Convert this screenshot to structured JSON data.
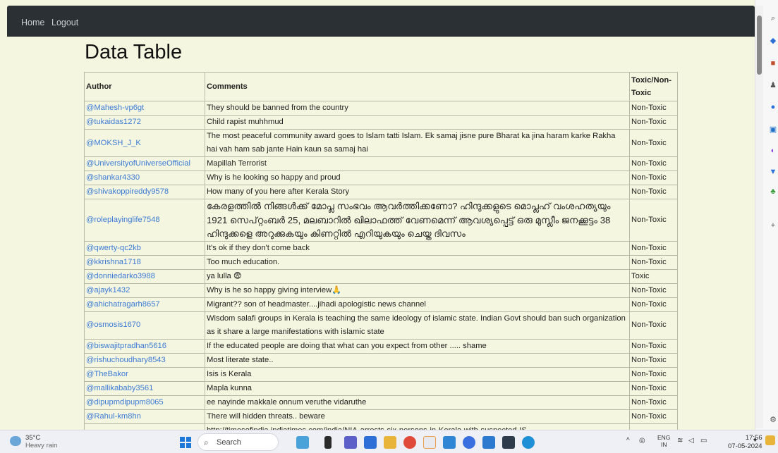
{
  "nav": {
    "home": "Home",
    "logout": "Logout"
  },
  "page_title": "Data Table",
  "table": {
    "headers": {
      "author": "Author",
      "comments": "Comments",
      "toxic": "Toxic/Non-Toxic"
    },
    "rows": [
      {
        "author": "@Mahesh-vp6gt",
        "comment": "They should be banned from the country",
        "label": "Non-Toxic"
      },
      {
        "author": "@tukaidas1272",
        "comment": "Child rapist muhhmud",
        "label": "Non-Toxic"
      },
      {
        "author": "@MOKSH_J_K",
        "comment": "The most peaceful community award goes to Islam tatti Islam. Ek samaj jisne pure Bharat ka jina haram karke Rakha hai vah ham sab jante Hain kaun sa samaj hai",
        "label": "Non-Toxic"
      },
      {
        "author": "@UniversityofUniverseOfficial",
        "comment": "Mapillah Terrorist",
        "label": "Non-Toxic"
      },
      {
        "author": "@shankar4330",
        "comment": "Why is he looking so happy and proud",
        "label": "Non-Toxic"
      },
      {
        "author": "@shivakoppireddy9578",
        "comment": "How many of you here after Kerala Story",
        "label": "Non-Toxic"
      },
      {
        "author": "@roleplayinglife7548",
        "comment": "കേരളത്തിൽ നിങ്ങൾക്ക് മോപ്ല സംഭവം ആവർത്തിക്കണോ? ഹിന്ദുക്കളുടെ മൊപ്ലഹ് വംശഹത്യയും 1921 സെപ്റ്റംബർ 25, മലബാറിൽ ഖിലാഫത്ത് വേണമെന്ന് ആവശ്യപ്പെട്ട് ഒരു മുസ്ലീം ജനക്കൂട്ടം 38 ഹിന്ദുക്കളെ അറുക്കുകയും കിണറ്റിൽ എറിയുകയും ചെയ്ത ദിവസം",
        "label": "Non-Toxic",
        "big": true
      },
      {
        "author": "@qwerty-qc2kb",
        "comment": "It's ok if they don't come back",
        "label": "Non-Toxic"
      },
      {
        "author": "@kkrishna1718",
        "comment": "Too much education.",
        "label": "Non-Toxic"
      },
      {
        "author": "@donniedarko3988",
        "comment": "ya lulla 😨",
        "label": "Toxic"
      },
      {
        "author": "@ajayk1432",
        "comment": "Why is he so happy giving interview🙏",
        "label": "Non-Toxic"
      },
      {
        "author": "@ahichatragarh8657",
        "comment": "Migrant?? son of headmaster....jihadi apologistic news channel",
        "label": "Non-Toxic"
      },
      {
        "author": "@osmosis1670",
        "comment": "Wisdom salafi groups in Kerala is teaching the same ideology of islamic state. Indian Govt should ban such organization as it share a large manifestations with islamic state",
        "label": "Non-Toxic"
      },
      {
        "author": "@biswajitpradhan5616",
        "comment": "If the educated people are doing that what can you expect from other ..... shame",
        "label": "Non-Toxic"
      },
      {
        "author": "@rishuchoudhary8543",
        "comment": "Most literate state..",
        "label": "Non-Toxic"
      },
      {
        "author": "@TheBakor",
        "comment": "Isis is Kerala",
        "label": "Non-Toxic"
      },
      {
        "author": "@mallikababy3561",
        "comment": "Mapla kunna",
        "label": "Non-Toxic"
      },
      {
        "author": "@dipupmdipupm8065",
        "comment": "ee nayinde makkale onnum veruthe vidaruthe",
        "label": "Non-Toxic"
      },
      {
        "author": "@Rahul-km8hn",
        "comment": "There will hidden threats.. beware",
        "label": "Non-Toxic"
      },
      {
        "author": "",
        "comment": "http://timesofindia.indiatimes.com/india/NIA-arrests-six-persons-in-Kerala-with-suspected-IS-",
        "label": ""
      }
    ]
  },
  "taskbar": {
    "weather_temp": "35°C",
    "weather_desc": "Heavy rain",
    "search_label": "Search",
    "lang_top": "ENG",
    "lang_bottom": "IN",
    "time": "17:56",
    "date": "07-05-2024"
  },
  "colors": {
    "navbar": "#2b3035",
    "page_bg": "#f5f6df",
    "link": "#3c7bd6"
  }
}
